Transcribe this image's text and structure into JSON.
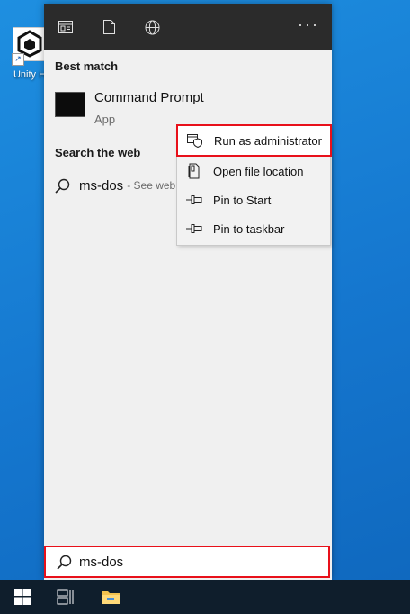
{
  "desktop": {
    "icon_label": "Unity H"
  },
  "topbar": {
    "icons": [
      "apps-icon",
      "documents-icon",
      "web-icon"
    ],
    "more_label": "···"
  },
  "best_match": {
    "heading": "Best match",
    "title": "Command Prompt",
    "subtitle": "App"
  },
  "search_web": {
    "heading": "Search the web",
    "query": "ms-dos",
    "hint": "- See web"
  },
  "context_menu": {
    "items": [
      {
        "label": "Run as administrator",
        "icon": "shield-icon"
      },
      {
        "label": "Open file location",
        "icon": "file-location-icon"
      },
      {
        "label": "Pin to Start",
        "icon": "pin-icon"
      },
      {
        "label": "Pin to taskbar",
        "icon": "pin-icon"
      }
    ]
  },
  "search_box": {
    "value": "ms-dos"
  },
  "taskbar": {
    "icons": [
      "windows-start-icon",
      "task-view-icon",
      "file-explorer-icon"
    ]
  },
  "colors": {
    "highlight": "#e8101a",
    "topbar": "#2b2b2b",
    "taskbar": "#0f1e2c"
  }
}
